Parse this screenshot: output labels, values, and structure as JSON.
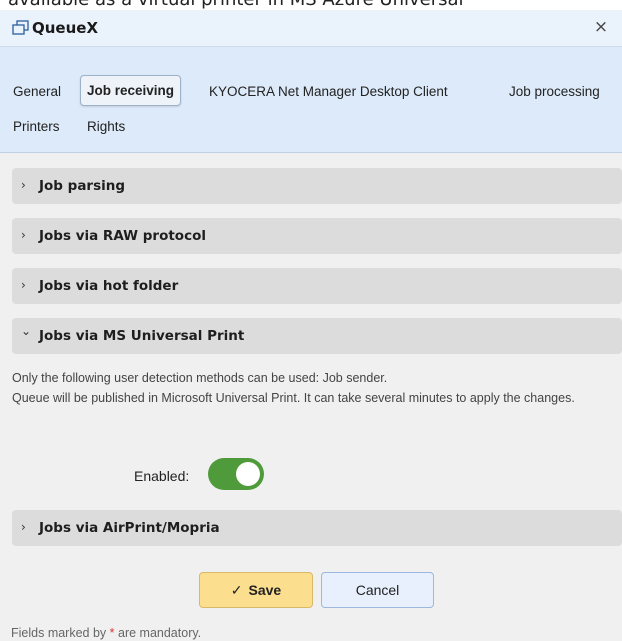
{
  "background_text": "available as a virtual printer in MS Azure Universal",
  "dialog": {
    "title": "QueueX",
    "close_label": "×"
  },
  "tabs": [
    {
      "label": "General",
      "active": false
    },
    {
      "label": "Job receiving",
      "active": true
    },
    {
      "label": "KYOCERA Net Manager Desktop Client",
      "active": false
    },
    {
      "label": "Job processing",
      "active": false
    },
    {
      "label": "Printers",
      "active": false
    },
    {
      "label": "Rights",
      "active": false
    }
  ],
  "panels": [
    {
      "label": "Job parsing",
      "expanded": false,
      "chevron": "›"
    },
    {
      "label": "Jobs via RAW protocol",
      "expanded": false,
      "chevron": "›"
    },
    {
      "label": "Jobs via hot folder",
      "expanded": false,
      "chevron": "›"
    },
    {
      "label": "Jobs via MS Universal Print",
      "expanded": true,
      "chevron": "⌄"
    },
    {
      "label": "Jobs via AirPrint/Mopria",
      "expanded": false,
      "chevron": "›"
    }
  ],
  "universal_print": {
    "info_line1": "Only the following user detection methods can be used: Job sender.",
    "info_line2": "Queue will be published in Microsoft Universal Print. It can take several minutes to apply the changes.",
    "enabled_label": "Enabled:",
    "enabled": true
  },
  "buttons": {
    "save_label": "Save",
    "save_icon": "✓",
    "cancel_label": "Cancel"
  },
  "footer": {
    "mandatory_prefix": "Fields marked by ",
    "mandatory_star": "*",
    "mandatory_suffix": " are mandatory."
  },
  "colors": {
    "toggle_on": "#4f9a3b",
    "save_button": "#fbdf8e",
    "header_blue": "#dceaf9"
  }
}
